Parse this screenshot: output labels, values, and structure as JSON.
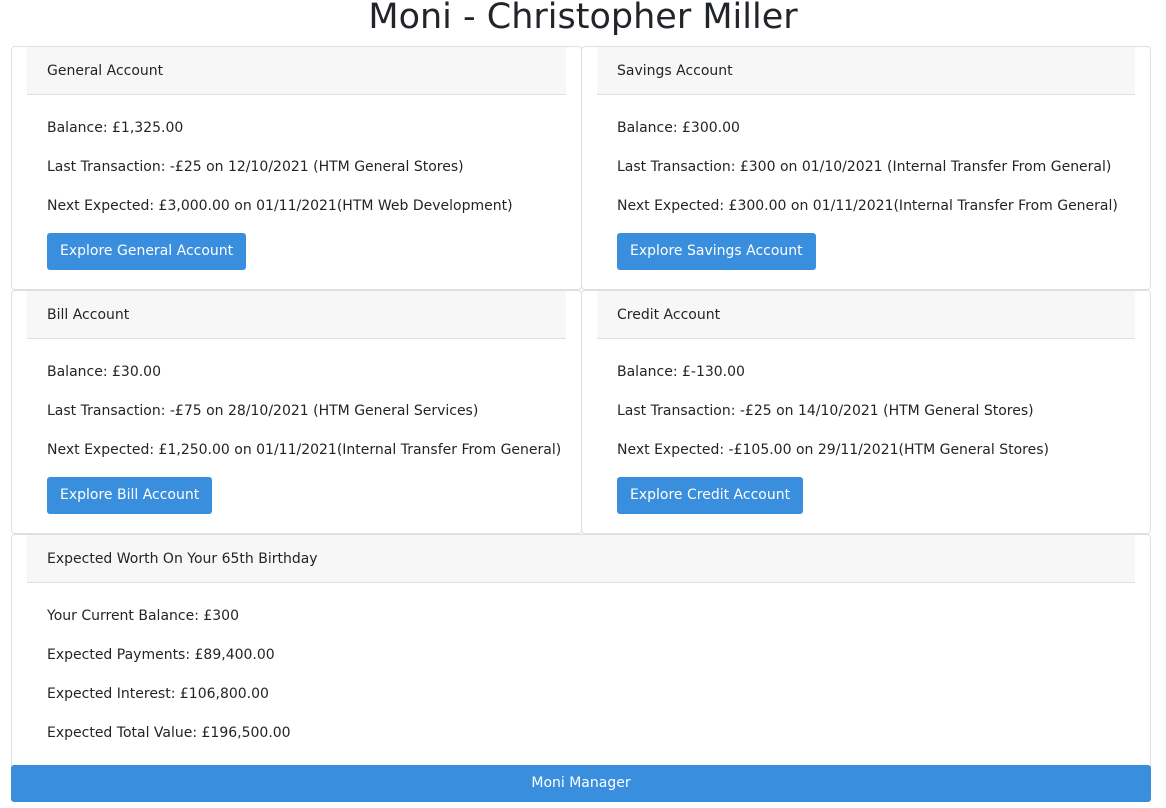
{
  "title": "Moni - Christopher Miller",
  "accounts": [
    {
      "name": "General Account",
      "balance": "Balance: £1,325.00",
      "last_transaction": "Last Transaction: -£25 on 12/10/2021 (HTM General Stores)",
      "next_expected": "Next Expected: £3,000.00 on 01/11/2021(HTM Web Development)",
      "button": "Explore General Account"
    },
    {
      "name": "Savings Account",
      "balance": "Balance: £300.00",
      "last_transaction": "Last Transaction: £300 on 01/10/2021 (Internal Transfer From General)",
      "next_expected": "Next Expected: £300.00 on 01/11/2021(Internal Transfer From General)",
      "button": "Explore Savings Account"
    },
    {
      "name": "Bill Account",
      "balance": "Balance: £30.00",
      "last_transaction": "Last Transaction: -£75 on 28/10/2021 (HTM General Services)",
      "next_expected": "Next Expected: £1,250.00 on 01/11/2021(Internal Transfer From General)",
      "button": "Explore Bill Account"
    },
    {
      "name": "Credit Account",
      "balance": "Balance: £-130.00",
      "last_transaction": "Last Transaction: -£25 on 14/10/2021 (HTM General Stores)",
      "next_expected": "Next Expected: -£105.00 on 29/11/2021(HTM General Stores)",
      "button": "Explore Credit Account"
    }
  ],
  "worth": {
    "header": "Expected Worth On Your 65th Birthday",
    "current_balance": "Your Current Balance: £300",
    "expected_payments": "Expected Payments: £89,400.00",
    "expected_interest": "Expected Interest: £106,800.00",
    "expected_total": "Expected Total Value: £196,500.00"
  },
  "footer": {
    "label": "Moni Manager"
  },
  "colors": {
    "accent": "#3a8ede",
    "header_bg": "#f7f7f7",
    "border": "#dfdfdf"
  }
}
